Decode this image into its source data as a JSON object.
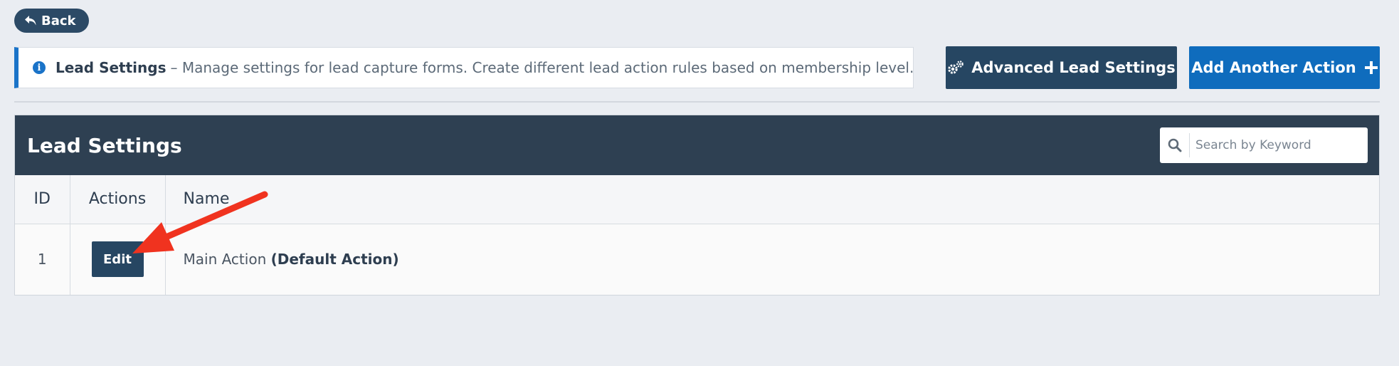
{
  "back_button": {
    "label": "Back",
    "icon": "reply-arrow-icon"
  },
  "info_box": {
    "icon": "info-icon",
    "title": "Lead Settings",
    "description": "– Manage settings for lead capture forms. Create different lead action rules based on membership level."
  },
  "toolbar": {
    "advanced_label": "Advanced Lead Settings",
    "advanced_icon": "gears-icon",
    "add_label": "Add Another Action",
    "add_icon": "plus-icon"
  },
  "panel": {
    "title": "Lead Settings",
    "search": {
      "placeholder": "Search by Keyword",
      "value": "",
      "icon": "search-icon"
    }
  },
  "table": {
    "columns": [
      "ID",
      "Actions",
      "Name"
    ],
    "rows": [
      {
        "id": "1",
        "action_label": "Edit",
        "name": "Main Action",
        "name_suffix": "(Default Action)"
      }
    ]
  },
  "colors": {
    "page_bg": "#eaedf2",
    "dark_navy": "#264662",
    "panel_header": "#2e4052",
    "brand_blue": "#0f6cbd",
    "annotation_arrow": "#f0331f"
  }
}
